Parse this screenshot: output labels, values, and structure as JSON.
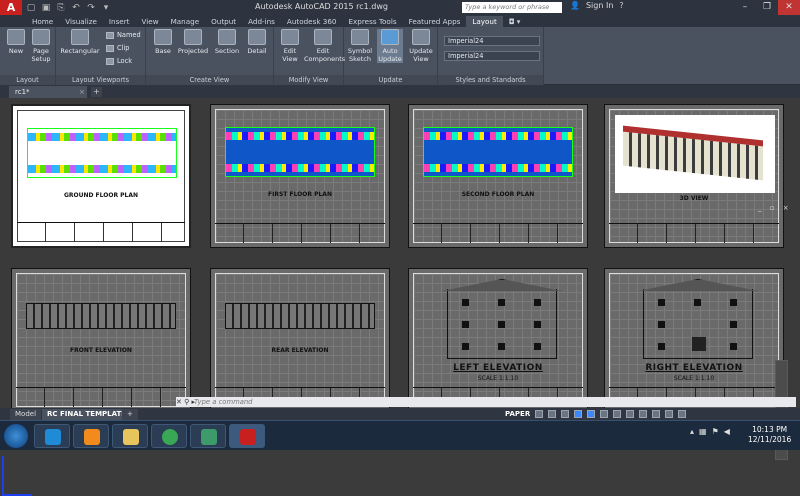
{
  "window": {
    "logo": "A",
    "title": "Autodesk AutoCAD 2015    rc1.dwg",
    "search_placeholder": "Type a keyword or phrase",
    "sign_in": "Sign In",
    "minimize": "–",
    "restore": "❐",
    "close": "✕"
  },
  "quick_access": [
    "▢",
    "▣",
    "⎘",
    "↶",
    "↷",
    "▾"
  ],
  "ribbon_tabs": [
    {
      "label": "Home"
    },
    {
      "label": "Visualize"
    },
    {
      "label": "Insert"
    },
    {
      "label": "View"
    },
    {
      "label": "Manage"
    },
    {
      "label": "Output"
    },
    {
      "label": "Add-ins"
    },
    {
      "label": "Autodesk 360"
    },
    {
      "label": "Express Tools"
    },
    {
      "label": "Featured Apps"
    },
    {
      "label": "Layout"
    },
    {
      "label": "◘ ▾"
    }
  ],
  "ribbon": {
    "layout": {
      "label": "Layout",
      "new": "New",
      "page_setup": "Page Setup"
    },
    "viewports": {
      "label": "Layout Viewports",
      "rectangular": "Rectangular",
      "named": "Named",
      "clip": "Clip",
      "lock": "Lock"
    },
    "create_view": {
      "label": "Create View",
      "base": "Base",
      "projected": "Projected",
      "section": "Section",
      "detail": "Detail"
    },
    "modify_view": {
      "label": "Modify View",
      "edit_view": "Edit View",
      "edit_components": "Edit Components"
    },
    "update": {
      "label": "Update",
      "symbol_sketch": "Symbol Sketch",
      "auto_update": "Auto Update",
      "update_view": "Update View"
    },
    "styles": {
      "label": "Styles and Standards",
      "style1": "Imperial24",
      "style2": "Imperial24"
    }
  },
  "file_tab": {
    "name": "rc1*",
    "close": "×",
    "add": "+"
  },
  "viewport_controls": "_ ▫ ×",
  "sheets": [
    {
      "caption": "GROUND FLOOR PLAN"
    },
    {
      "caption": "FIRST FLOOR PLAN"
    },
    {
      "caption": "SECOND FLOOR PLAN"
    },
    {
      "caption": "3D VIEW"
    },
    {
      "caption": "FRONT ELEVATION"
    },
    {
      "caption": "REAR ELEVATION"
    },
    {
      "caption": "LEFT ELEVATION",
      "scale": "SCALE          1:1.10"
    },
    {
      "caption": "RIGHT ELEVATION",
      "scale": "SCALE          1:1.10"
    }
  ],
  "command_line": {
    "placeholder": "Type a command",
    "icons": "✕ ⚲ ▸"
  },
  "layout_tabs": {
    "model": "Model",
    "active": "RC FINAL TEMPLATE",
    "add": "+"
  },
  "status": {
    "paper": "PAPER"
  },
  "taskbar": {
    "apps": [
      {
        "name": "internet-explorer",
        "color": "#1f8ad6"
      },
      {
        "name": "media-player",
        "color": "#f28b1c"
      },
      {
        "name": "file-explorer",
        "color": "#e8c45c"
      },
      {
        "name": "chrome",
        "color": "#3aa757"
      },
      {
        "name": "notepad",
        "color": "#3c9a6b"
      },
      {
        "name": "autocad",
        "color": "#c81f1f"
      }
    ],
    "time": "10:13 PM",
    "date": "12/11/2016"
  }
}
